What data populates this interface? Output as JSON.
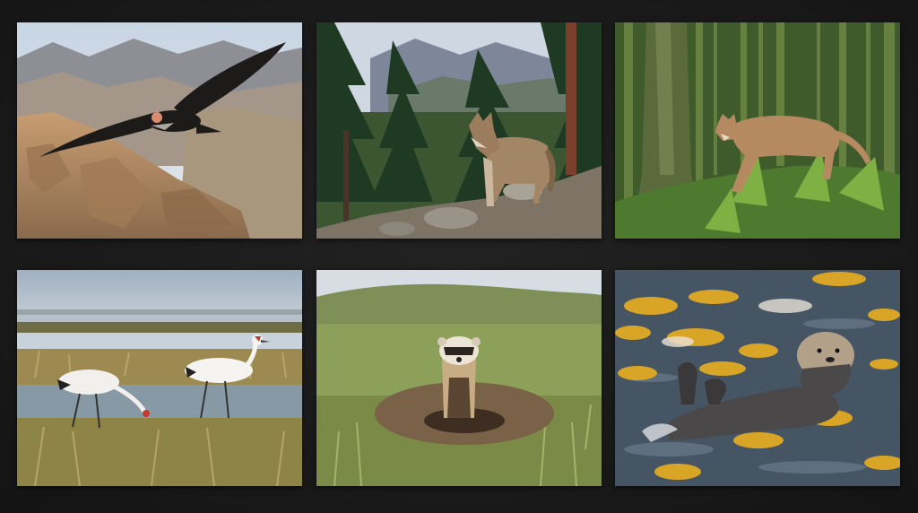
{
  "gallery": {
    "tiles": [
      {
        "subject": "california-condor",
        "scene": "canyon-cliffs"
      },
      {
        "subject": "gray-wolf",
        "scene": "pine-forest-mountains"
      },
      {
        "subject": "cougar",
        "scene": "mossy-rainforest"
      },
      {
        "subject": "whooping-cranes",
        "scene": "marsh-wetland"
      },
      {
        "subject": "black-footed-ferret",
        "scene": "grassland-burrow"
      },
      {
        "subject": "sea-otter",
        "scene": "kelp-water"
      }
    ]
  },
  "colors": {
    "background": "#1b1b1b",
    "sky": "#c9d6e2",
    "canyon_rock": "#b08c66",
    "forest_green": "#2f4a2a",
    "moss": "#6b8a3a",
    "marsh_grass": "#9b8a52",
    "water": "#8fa3b2",
    "kelp": "#d9a526"
  }
}
